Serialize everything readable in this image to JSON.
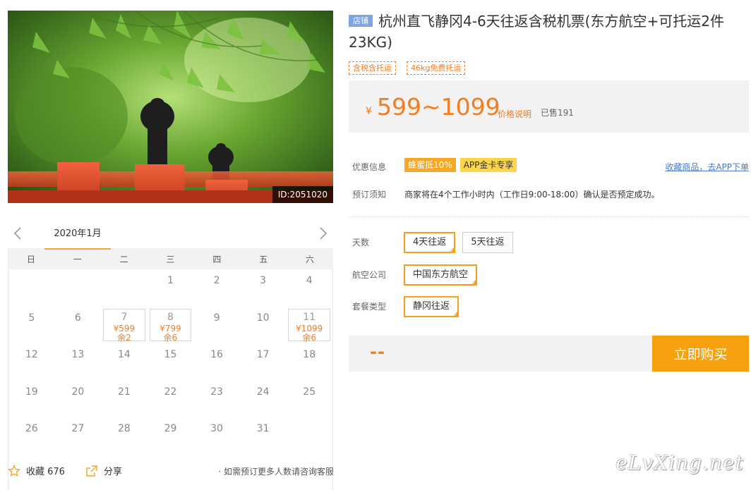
{
  "photo": {
    "id_label": "ID:2051020"
  },
  "calendar": {
    "month": "2020年1月",
    "weekdays": [
      "日",
      "一",
      "二",
      "三",
      "四",
      "五",
      "六"
    ],
    "weeks": [
      [
        {
          "d": ""
        },
        {
          "d": ""
        },
        {
          "d": ""
        },
        {
          "d": "1"
        },
        {
          "d": "2"
        },
        {
          "d": "3"
        },
        {
          "d": "4"
        }
      ],
      [
        {
          "d": "5"
        },
        {
          "d": "6"
        },
        {
          "d": "7",
          "price": "¥599",
          "left": "余2"
        },
        {
          "d": "8",
          "price": "¥799",
          "left": "余6"
        },
        {
          "d": "9"
        },
        {
          "d": "10"
        },
        {
          "d": "11",
          "price": "¥1099",
          "left": "余6"
        }
      ],
      [
        {
          "d": "12"
        },
        {
          "d": "13"
        },
        {
          "d": "14"
        },
        {
          "d": "15"
        },
        {
          "d": "16"
        },
        {
          "d": "17"
        },
        {
          "d": "18"
        }
      ],
      [
        {
          "d": "19"
        },
        {
          "d": "20"
        },
        {
          "d": "21"
        },
        {
          "d": "22"
        },
        {
          "d": "23"
        },
        {
          "d": "24"
        },
        {
          "d": "25"
        }
      ],
      [
        {
          "d": "26"
        },
        {
          "d": "27"
        },
        {
          "d": "28"
        },
        {
          "d": "29"
        },
        {
          "d": "30"
        },
        {
          "d": "31"
        },
        {
          "d": ""
        }
      ]
    ]
  },
  "bottom": {
    "fav_label": "收藏 676",
    "share_label": "分享",
    "consult": "· 如需预订更多人数请咨询客服"
  },
  "product": {
    "shop_tag": "店铺",
    "title": "杭州直飞静冈4-6天往返含税机票(东方航空+可托运2件23KG)",
    "tags": [
      "含税含托运",
      "46kg免费托运"
    ],
    "yen": "¥",
    "price": "599~1099",
    "price_note": "价格说明",
    "sold": "已售191"
  },
  "discount": {
    "label": "优惠信息",
    "tags": [
      "蜂蜜抵10%",
      "APP金卡专享"
    ],
    "app_link": "收藏商品，去APP下单"
  },
  "notice": {
    "label": "预订须知",
    "text": "商家将在4个工作小时内（工作日9:00-18:00）确认是否预定成功。"
  },
  "options": {
    "days": {
      "label": "天数",
      "items": [
        "4天往返",
        "5天往返"
      ],
      "selected": 0
    },
    "airline": {
      "label": "航空公司",
      "items": [
        "中国东方航空"
      ],
      "selected": 0
    },
    "package": {
      "label": "套餐类型",
      "items": [
        "静冈往返"
      ],
      "selected": 0
    }
  },
  "buy": {
    "total": "--",
    "button": "立即购买"
  },
  "watermark": "eLvXing.net",
  "colors": {
    "accent": "#f57c1f",
    "button": "#f7a10f",
    "link": "#4a7ac9"
  }
}
